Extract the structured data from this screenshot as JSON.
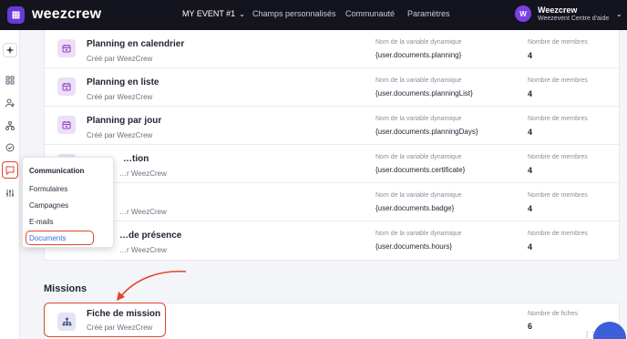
{
  "topbar": {
    "logo_text": "weezcrew",
    "event_label": "MY EVENT #1",
    "nav": [
      "Champs personnalisés",
      "Communauté",
      "Paramètres"
    ],
    "avatar_letter": "W",
    "user_name": "Weezcrew",
    "user_sub": "Weezevent Centre d'aide"
  },
  "documents": [
    {
      "title": "Planning en calendrier",
      "sub": "Créé par WeezCrew",
      "var_label": "Nom de la variable dynamique",
      "var": "{user.documents.planning}",
      "count_label": "Nombre de membres",
      "count": "4"
    },
    {
      "title": "Planning en liste",
      "sub": "Créé par WeezCrew",
      "var_label": "Nom de la variable dynamique",
      "var": "{user.documents.planningList}",
      "count_label": "Nombre de membres",
      "count": "4"
    },
    {
      "title": "Planning par jour",
      "sub": "Créé par WeezCrew",
      "var_label": "Nom de la variable dynamique",
      "var": "{user.documents.planningDays}",
      "count_label": "Nombre de membres",
      "count": "4"
    },
    {
      "title": "…tion",
      "sub": "…r WeezCrew",
      "var_label": "Nom de la variable dynamique",
      "var": "{user.documents.certificate}",
      "count_label": "Nombre de membres",
      "count": "4"
    },
    {
      "title": "",
      "sub": "…r WeezCrew",
      "var_label": "Nom de la variable dynamique",
      "var": "{user.documents.badge}",
      "count_label": "Nombre de membres",
      "count": "4"
    },
    {
      "title": "…de présence",
      "sub": "…r WeezCrew",
      "var_label": "Nom de la variable dynamique",
      "var": "{user.documents.hours}",
      "count_label": "Nombre de membres",
      "count": "4"
    }
  ],
  "popover": {
    "heading": "Communication",
    "items": [
      "Formulaires",
      "Campagnes",
      "E-mails",
      "Documents"
    ],
    "active": "Documents"
  },
  "missions": {
    "section_title": "Missions",
    "item": {
      "title": "Fiche de mission",
      "sub": "Créé par WeezCrew",
      "count_label": "Nombre de fiches",
      "count": "6"
    }
  },
  "colors": {
    "topbar": "#14141e",
    "accent": "#6c39d6",
    "highlight": "#e0462a",
    "link": "#2f6fd8"
  }
}
